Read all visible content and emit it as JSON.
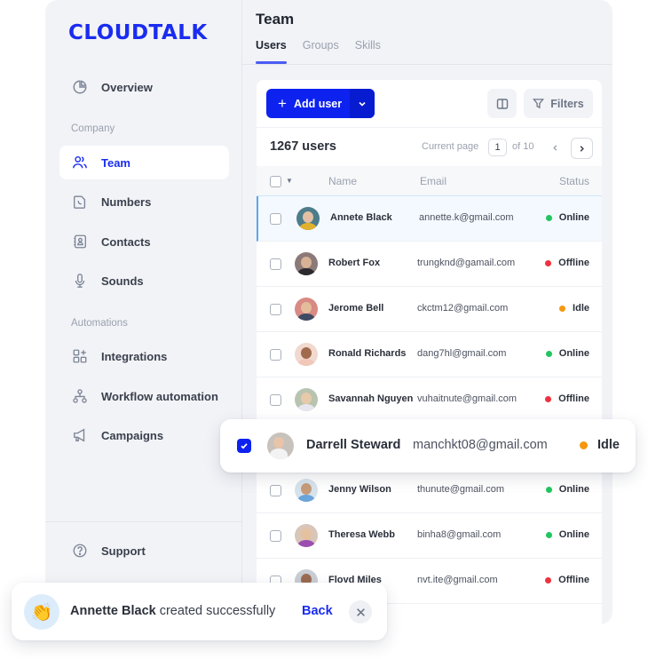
{
  "brand": {
    "logo_text": "CLOUDTALK",
    "accent": "#1a2cf0"
  },
  "sidebar": {
    "items": [
      {
        "id": "overview",
        "label": "Overview",
        "icon": "pie-chart-icon"
      },
      {
        "id": "team",
        "label": "Team",
        "icon": "users-icon",
        "active": true
      },
      {
        "id": "numbers",
        "label": "Numbers",
        "icon": "phone-file-icon"
      },
      {
        "id": "contacts",
        "label": "Contacts",
        "icon": "contact-book-icon"
      },
      {
        "id": "sounds",
        "label": "Sounds",
        "icon": "microphone-icon"
      },
      {
        "id": "integrations",
        "label": "Integrations",
        "icon": "apps-add-icon"
      },
      {
        "id": "workflow",
        "label": "Workflow automation",
        "icon": "workflow-icon"
      },
      {
        "id": "campaigns",
        "label": "Campaigns",
        "icon": "megaphone-icon"
      },
      {
        "id": "support",
        "label": "Support",
        "icon": "help-circle-icon"
      }
    ],
    "sections": {
      "company": "Company",
      "automations": "Automations"
    }
  },
  "header": {
    "title": "Team",
    "tabs": [
      {
        "label": "Users",
        "active": true
      },
      {
        "label": "Groups"
      },
      {
        "label": "Skills"
      }
    ]
  },
  "toolbar": {
    "add_user_label": "Add user",
    "filters_label": "Filters"
  },
  "summary": {
    "count_label": "1267 users",
    "current_page_label": "Current page",
    "current_page": "1",
    "of_label": "of 10"
  },
  "table": {
    "columns": {
      "name": "Name",
      "email": "Email",
      "status": "Status"
    },
    "status_colors": {
      "Online": "#22c55e",
      "Offline": "#f0313f",
      "Idle": "#f5980f"
    },
    "rows": [
      {
        "name": "Annete Black",
        "email": "annette.k@gmail.com",
        "status": "Online",
        "highlight": true
      },
      {
        "name": "Robert Fox",
        "email": "trungknd@gamail.com",
        "status": "Offline"
      },
      {
        "name": "Jerome Bell",
        "email": "ckctm12@gmail.com",
        "status": "Idle"
      },
      {
        "name": "Ronald Richards",
        "email": "dang7hl@gmail.com",
        "status": "Online"
      },
      {
        "name": "Savannah Nguyen",
        "email": "vuhaitnute@gmail.com",
        "status": "Offline"
      },
      {
        "name": "Darrell Steward",
        "email": "manchkt08@gmail.com",
        "status": "Idle",
        "selected": true
      },
      {
        "name": "Jenny Wilson",
        "email": "thunute@gmail.com",
        "status": "Online"
      },
      {
        "name": "Theresa Webb",
        "email": "binha8@gmail.com",
        "status": "Online"
      },
      {
        "name": "Floyd Miles",
        "email": "nvt.ite@gmail.com",
        "status": "Offline"
      }
    ]
  },
  "floating_row": {
    "name": "Darrell Steward",
    "email": "manchkt08@gmail.com",
    "status": "Idle",
    "checked": true
  },
  "toast": {
    "emoji": "👏",
    "subject": "Annette Black",
    "message": " created successfully",
    "action_label": "Back"
  }
}
